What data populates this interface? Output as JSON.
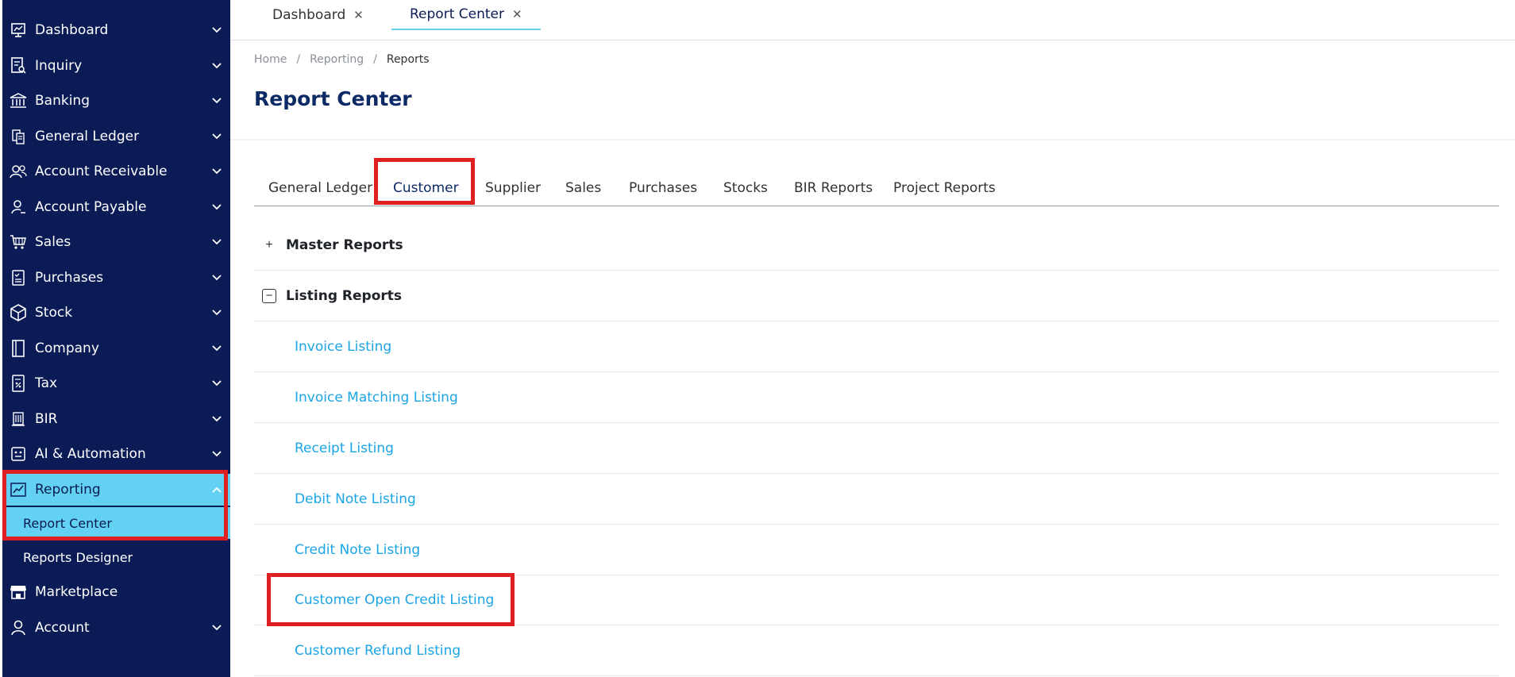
{
  "sidebar": {
    "items": [
      {
        "label": "Dashboard",
        "icon": "dashboard-icon"
      },
      {
        "label": "Inquiry",
        "icon": "inquiry-icon"
      },
      {
        "label": "Banking",
        "icon": "bank-icon"
      },
      {
        "label": "General Ledger",
        "icon": "ledger-icon"
      },
      {
        "label": "Account Receivable",
        "icon": "receivable-icon"
      },
      {
        "label": "Account Payable",
        "icon": "payable-icon"
      },
      {
        "label": "Sales",
        "icon": "cart-icon"
      },
      {
        "label": "Purchases",
        "icon": "purchases-icon"
      },
      {
        "label": "Stock",
        "icon": "box-icon"
      },
      {
        "label": "Company",
        "icon": "company-icon"
      },
      {
        "label": "Tax",
        "icon": "tax-icon"
      },
      {
        "label": "BIR",
        "icon": "bir-icon"
      },
      {
        "label": "AI & Automation",
        "icon": "robot-icon"
      },
      {
        "label": "Reporting",
        "icon": "chart-icon"
      },
      {
        "label": "Marketplace",
        "icon": "store-icon"
      },
      {
        "label": "Account",
        "icon": "user-icon"
      }
    ],
    "reporting_sub": {
      "report_center": "Report Center",
      "reports_designer": "Reports Designer"
    },
    "colors": {
      "background": "#0b1b55",
      "active": "#63d2f2"
    }
  },
  "top_tabs": [
    {
      "label": "Dashboard",
      "close": "✕"
    },
    {
      "label": "Report Center",
      "close": "✕"
    }
  ],
  "breadcrumb": {
    "home": "Home",
    "reporting": "Reporting",
    "reports": "Reports",
    "separator": "/"
  },
  "page_title": "Report Center",
  "report_tabs": [
    "General Ledger",
    "Customer",
    "Supplier",
    "Sales",
    "Purchases",
    "Stocks",
    "BIR Reports",
    "Project Reports"
  ],
  "groups": {
    "master": {
      "label": "Master Reports",
      "toggle": "+"
    },
    "listing": {
      "label": "Listing Reports",
      "toggle": "−"
    }
  },
  "listing_reports": [
    "Invoice Listing",
    "Invoice Matching Listing",
    "Receipt Listing",
    "Debit Note Listing",
    "Credit Note Listing",
    "Customer Open Credit Listing",
    "Customer Refund Listing"
  ],
  "colors": {
    "title": "#0b2a66",
    "link": "#1ba4e6",
    "highlight": "#e02020"
  }
}
